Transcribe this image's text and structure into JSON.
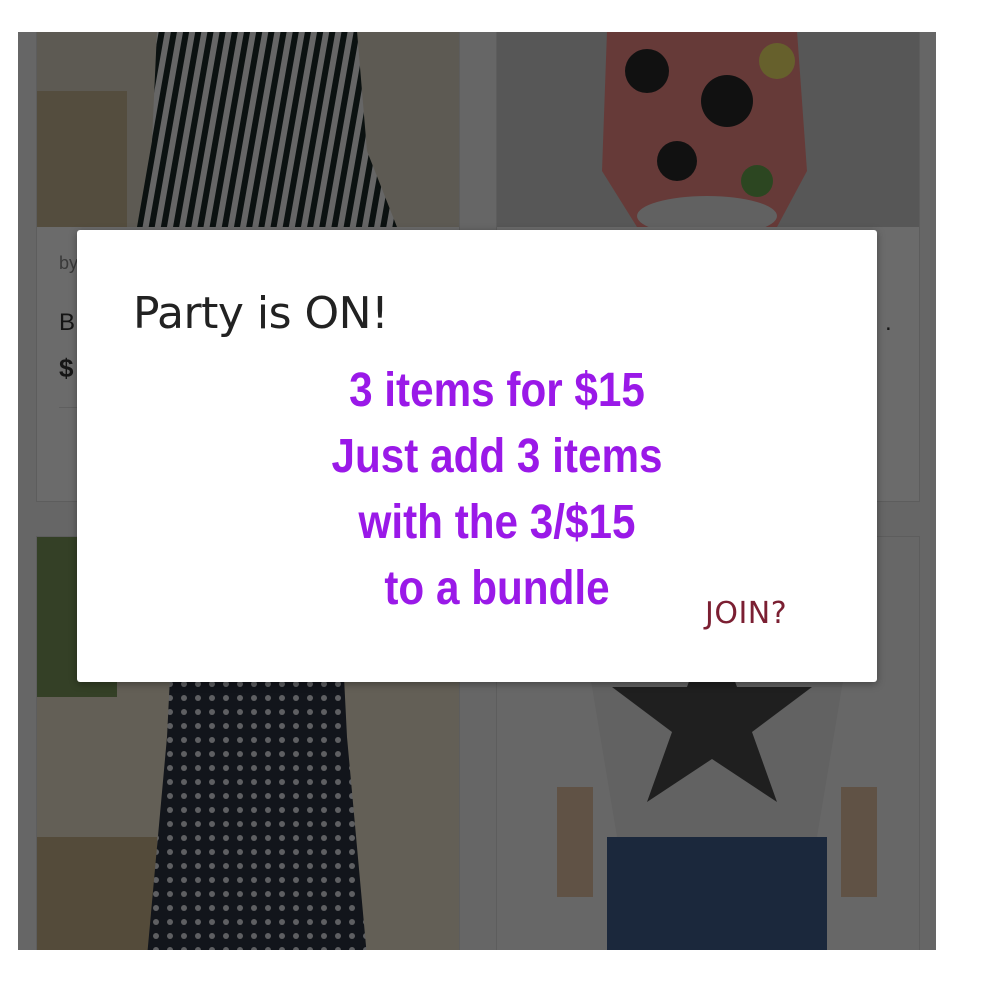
{
  "listing": {
    "cards": [
      {
        "by": "by",
        "title": "B",
        "price": "$"
      },
      {
        "title": "."
      }
    ]
  },
  "dialog": {
    "title": "Party is ON!",
    "promo_lines": [
      "3 items for $15",
      "Just add 3 items",
      "with the 3/$15",
      "to a bundle"
    ],
    "join_label": "JOIN?"
  },
  "colors": {
    "promo_text": "#9a19e8",
    "join_text": "#7b1f32",
    "overlay": "rgba(0,0,0,0.58)"
  }
}
